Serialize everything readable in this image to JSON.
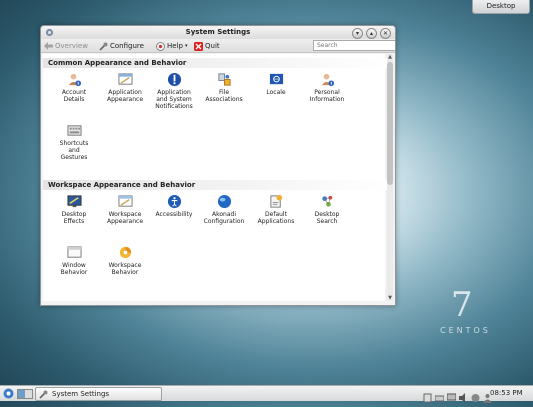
{
  "desktop": {
    "widget_label": "Desktop",
    "brand_number": "7",
    "brand_word": "CENTOS"
  },
  "window": {
    "title": "System Settings",
    "toolbar": {
      "overview": "Overview",
      "configure": "Configure",
      "help": "Help",
      "quit": "Quit"
    },
    "search": {
      "placeholder": "Search"
    },
    "sections": [
      {
        "title": "Common Appearance and Behavior",
        "items": [
          {
            "label": "Account\nDetails",
            "icon": "account-details-icon"
          },
          {
            "label": "Application\nAppearance",
            "icon": "application-appearance-icon"
          },
          {
            "label": "Application\nand System\nNotifications",
            "icon": "notifications-icon"
          },
          {
            "label": "File\nAssociations",
            "icon": "file-associations-icon"
          },
          {
            "label": "Locale",
            "icon": "locale-icon"
          },
          {
            "label": "Personal\nInformation",
            "icon": "personal-information-icon"
          },
          {
            "label": "Shortcuts\nand\nGestures",
            "icon": "shortcuts-gestures-icon"
          }
        ]
      },
      {
        "title": "Workspace Appearance and Behavior",
        "items": [
          {
            "label": "Desktop\nEffects",
            "icon": "desktop-effects-icon"
          },
          {
            "label": "Workspace\nAppearance",
            "icon": "workspace-appearance-icon"
          },
          {
            "label": "Accessibility",
            "icon": "accessibility-icon"
          },
          {
            "label": "Akonadi\nConfiguration",
            "icon": "akonadi-icon"
          },
          {
            "label": "Default\nApplications",
            "icon": "default-applications-icon"
          },
          {
            "label": "Desktop\nSearch",
            "icon": "desktop-search-icon"
          },
          {
            "label": "Window\nBehavior",
            "icon": "window-behavior-icon"
          },
          {
            "label": "Workspace\nBehavior",
            "icon": "workspace-behavior-icon"
          }
        ]
      }
    ]
  },
  "taskbar": {
    "task_label": "System Settings",
    "clock": "08:53 PM"
  }
}
